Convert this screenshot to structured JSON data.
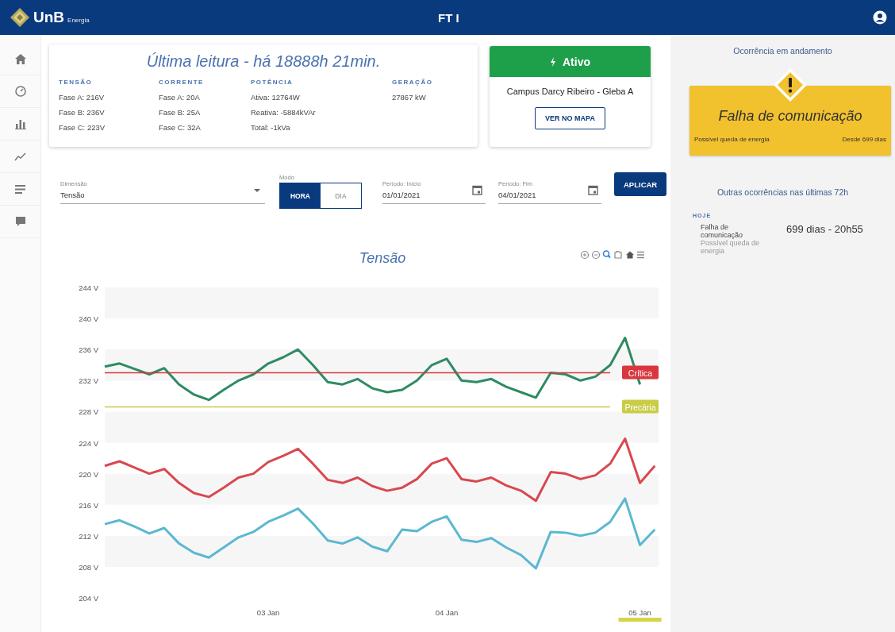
{
  "header": {
    "logo": "UnB",
    "logo_sub": "Energia",
    "title": "FT I"
  },
  "last_reading": {
    "title": "Última leitura - há 18888h 21min.",
    "groups": [
      {
        "heading": "TENSÃO",
        "lines": [
          "Fase A: 216V",
          "Fase B: 236V",
          "Fase C: 223V"
        ]
      },
      {
        "heading": "CORRENTE",
        "lines": [
          "Fase A: 20A",
          "Fase B: 25A",
          "Fase C: 32A"
        ]
      },
      {
        "heading": "POTÊNCIA",
        "lines": [
          "Ativa: 12764W",
          "Reativa: -5884kVAr",
          "Total: -1kVa"
        ]
      },
      {
        "heading": "GERAÇÃO",
        "lines": [
          "27867 kW"
        ]
      }
    ]
  },
  "status": {
    "label": "Ativo",
    "location": "Campus Darcy Ribeiro - Gleba A",
    "map_button": "VER NO MAPA"
  },
  "filters": {
    "dimension": {
      "label": "Dimensão",
      "value": "Tensão"
    },
    "mode": {
      "label": "Modo",
      "options": [
        {
          "label": "HORA",
          "selected": true
        },
        {
          "label": "DIA",
          "selected": false
        }
      ]
    },
    "start": {
      "label": "Período: Início",
      "value": "01/01/2021"
    },
    "end": {
      "label": "Período: Fim",
      "value": "04/01/2021"
    },
    "apply": "APLICAR"
  },
  "chart": {
    "chart_data": {
      "type": "line",
      "title": "Tensão",
      "categories": [
        null,
        null,
        null,
        null,
        null,
        null,
        null,
        null,
        null,
        null,
        null,
        "03 Jan",
        null,
        null,
        null,
        null,
        null,
        null,
        null,
        null,
        null,
        null,
        null,
        "04 Jan",
        null,
        null,
        null,
        null,
        null,
        null,
        null,
        null,
        null,
        null,
        null,
        null,
        "05 Jan",
        null
      ],
      "series": [
        {
          "color": "#2e8b62",
          "values": [
            233.8,
            234.2,
            233.5,
            232.8,
            233.6,
            231.5,
            230.2,
            229.5,
            230.8,
            232.0,
            232.8,
            234.2,
            235.0,
            236.0,
            234.0,
            231.8,
            231.5,
            232.2,
            231.0,
            230.5,
            230.8,
            232.0,
            234.0,
            234.8,
            232.0,
            231.8,
            232.2,
            231.2,
            230.5,
            229.8,
            233.0,
            232.8,
            232.0,
            232.5,
            234.0,
            237.5,
            231.5,
            null
          ]
        },
        {
          "color": "#d9484f",
          "values": [
            221.0,
            221.6,
            220.8,
            220.0,
            220.6,
            218.8,
            217.5,
            217.0,
            218.2,
            219.5,
            220.0,
            221.5,
            222.3,
            223.2,
            221.3,
            219.2,
            218.8,
            219.5,
            218.4,
            217.8,
            218.2,
            219.3,
            221.3,
            222.0,
            219.3,
            219.0,
            219.5,
            218.5,
            217.8,
            216.5,
            220.2,
            220.0,
            219.3,
            219.8,
            221.3,
            224.5,
            218.8,
            221.0
          ]
        },
        {
          "color": "#5bb8d0",
          "values": [
            213.5,
            214.0,
            213.2,
            212.3,
            213.0,
            211.0,
            209.8,
            209.2,
            210.5,
            211.8,
            212.5,
            213.8,
            214.6,
            215.5,
            213.6,
            211.4,
            211.0,
            211.8,
            210.6,
            210.0,
            212.8,
            212.6,
            213.8,
            214.5,
            211.5,
            211.2,
            211.7,
            210.5,
            209.5,
            207.8,
            212.5,
            212.4,
            212.0,
            212.4,
            213.8,
            216.8,
            210.8,
            212.8
          ]
        },
        {
          "name": "Crítica",
          "color": "#d9363e",
          "values": [
            233,
            233,
            233,
            233,
            233,
            233,
            233,
            233,
            233,
            233,
            233,
            233,
            233,
            233,
            233,
            233,
            233,
            233,
            233,
            233,
            233,
            233,
            233,
            233,
            233,
            233,
            233,
            233,
            233,
            233,
            233,
            233,
            233,
            233,
            233,
            null,
            null,
            null
          ]
        },
        {
          "name": "Precária",
          "color": "#c9cc45",
          "values": [
            228.6,
            228.6,
            228.6,
            228.6,
            228.6,
            228.6,
            228.6,
            228.6,
            228.6,
            228.6,
            228.6,
            228.6,
            228.6,
            228.6,
            228.6,
            228.6,
            228.6,
            228.6,
            228.6,
            228.6,
            228.6,
            228.6,
            228.6,
            228.6,
            228.6,
            228.6,
            228.6,
            228.6,
            228.6,
            228.6,
            228.6,
            228.6,
            228.6,
            228.6,
            228.6,
            null,
            null,
            null
          ]
        }
      ],
      "ylim": [
        204,
        244
      ],
      "yticks": [
        {
          "value": 204,
          "label": "204 V"
        },
        {
          "value": 208,
          "label": "208 V"
        },
        {
          "value": 212,
          "label": "212 V"
        },
        {
          "value": 216,
          "label": "216 V"
        },
        {
          "value": 220,
          "label": "220 V"
        },
        {
          "value": 224,
          "label": "224 V"
        },
        {
          "value": 228,
          "label": "228 V"
        },
        {
          "value": 232,
          "label": "232 V"
        },
        {
          "value": 236,
          "label": "236 V"
        },
        {
          "value": 240,
          "label": "240 V"
        },
        {
          "value": 244,
          "label": "244 V"
        }
      ],
      "stacked": false
    }
  },
  "occurrence": {
    "heading": "Ocorrência em andamento",
    "title": "Falha de comunicação",
    "cause": "Possível queda de energia",
    "since": "Desde 699 dias"
  },
  "others": {
    "heading": "Outras ocorrências nas últimas 72h",
    "groups": [
      {
        "day": "HOJE",
        "items": [
          {
            "title": "Falha de comunicação",
            "cause": "Possível queda de energia",
            "time": "699 dias - 20h55"
          }
        ]
      }
    ]
  }
}
